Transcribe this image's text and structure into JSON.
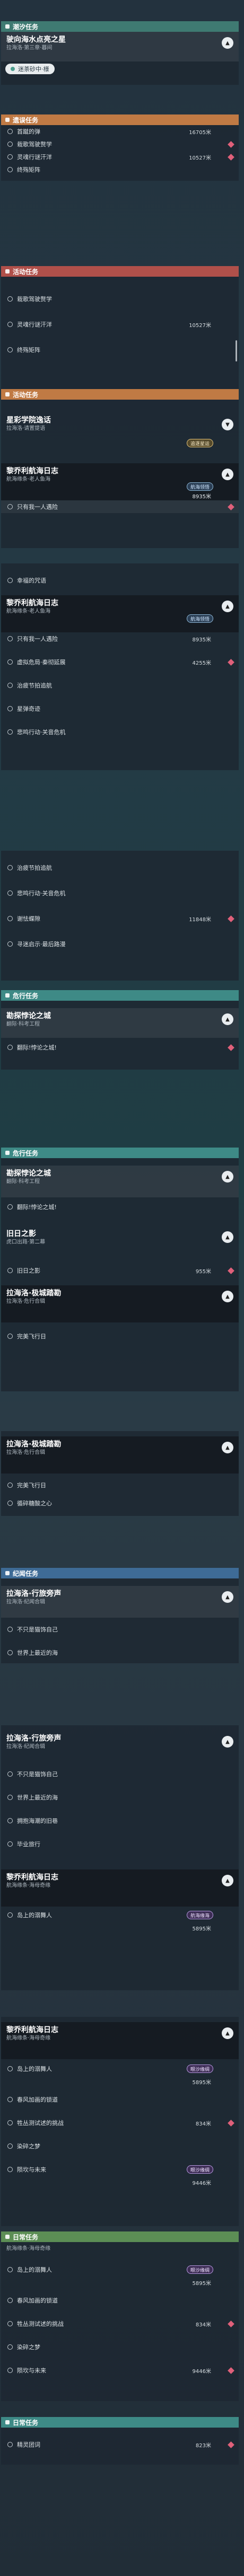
{
  "p1": {
    "header": "潮汐任务",
    "card": {
      "title": "驶向海水点亮之星",
      "sub": "拉海洛·第三章·暮间"
    },
    "pill": "迷茶砂中·様"
  },
  "p2": {
    "header": "遗误任务",
    "rows": [
      {
        "text": "首蹴的弹",
        "dist": "16705米"
      },
      {
        "text": "栽歌驾驶赘学",
        "dist": ""
      },
      {
        "text": "灵魂行谜汗洋",
        "dist": "10527米"
      },
      {
        "text": "终殇矩阵",
        "dist": ""
      }
    ]
  },
  "p3": {
    "header": "活动任务",
    "rows": [
      {
        "text": "栽歌驾驶赘学",
        "dist": ""
      },
      {
        "text": "灵魂行谜汗洋",
        "dist": "10527米"
      },
      {
        "text": "终殇矩阵",
        "dist": ""
      }
    ]
  },
  "p4": {
    "header": "活动任务",
    "card1": {
      "title": "星彩学院逸话",
      "sub": "拉海洛·请置提语"
    },
    "badge1": "追逐星运",
    "card2": {
      "title": "黎乔利航海日志",
      "sub": "航海缘条·老人鱼海"
    },
    "badge2": "航海领悟",
    "dist2": "8935米",
    "rows": [
      {
        "text": "只有我一人遇险",
        "dist": ""
      }
    ]
  },
  "p5": {
    "rows0": [
      {
        "text": "幸福的咒语",
        "dist": ""
      }
    ],
    "card": {
      "title": "黎乔利航海日志",
      "sub": "航海缘条·老人鱼海"
    },
    "badge": "航海领悟",
    "dist": "8935米",
    "rows": [
      {
        "text": "只有我一人遇险",
        "dist": "8935米"
      },
      {
        "text": "虚拟危局·秦彻延展",
        "dist": "4255米"
      },
      {
        "text": "治疲节拍追航",
        "dist": ""
      },
      {
        "text": "星弹奇迹",
        "dist": ""
      },
      {
        "text": "悲鸣行动·关音危机",
        "dist": ""
      }
    ]
  },
  "p6": {
    "rows": [
      {
        "text": "治疲节拍追航",
        "dist": ""
      },
      {
        "text": "悲鸣行动·关音危机",
        "dist": ""
      },
      {
        "text": "谢怯蝶隙",
        "dist": "11848米"
      },
      {
        "text": "寻迷启示·最后路漫",
        "dist": ""
      }
    ]
  },
  "p7": {
    "header": "危行任务",
    "card": {
      "title": "勘探悖论之城",
      "sub": "翻际·科考工程"
    },
    "rows": [
      {
        "text": "翻际!悖论之城!",
        "dist": ""
      }
    ]
  },
  "p8": {
    "header": "危行任务",
    "card1": {
      "title": "勘探悖论之城",
      "sub": "翻际·科考工程"
    },
    "rows1": [
      {
        "text": "翻际!悖论之城!",
        "dist": ""
      }
    ],
    "card2": {
      "title": "旧日之影",
      "sub": "虎口出路·第二幕"
    },
    "rows2": [
      {
        "text": "旧日之影",
        "dist": "955米"
      }
    ],
    "card3": {
      "title": "拉海洛·极城踏勘",
      "sub": "拉海洛·危行合辑"
    },
    "rows3": [
      {
        "text": "完美飞行日",
        "dist": ""
      }
    ]
  },
  "p9": {
    "card": {
      "title": "拉海洛·极城踏勘",
      "sub": "拉海洛·危行合辑"
    },
    "rows": [
      {
        "text": "完美飞行日",
        "dist": ""
      },
      {
        "text": "循碎糖酸之心",
        "dist": ""
      }
    ]
  },
  "p10": {
    "header": "纪闻任务",
    "card": {
      "title": "拉海洛·行旅旁声",
      "sub": "拉海洛·纪闻合辑"
    },
    "rows": [
      {
        "text": "不只是猫饰自己",
        "dist": ""
      },
      {
        "text": "世界上最近的海",
        "dist": ""
      }
    ]
  },
  "p11": {
    "card1": {
      "title": "拉海洛·行旅旁声",
      "sub": "拉海洛·纪闻合辑"
    },
    "rows1": [
      {
        "text": "不只是猫饰自己",
        "dist": ""
      },
      {
        "text": "世界上最近的海",
        "dist": ""
      },
      {
        "text": "拥抱海潮的旧巷",
        "dist": ""
      },
      {
        "text": "毕业旅行",
        "dist": ""
      }
    ],
    "card2": {
      "title": "黎乔利航海日志",
      "sub": "航海缘条·海母奇缘"
    },
    "rows2": [
      {
        "text": "岛上的溺舞人",
        "dist": "5895米"
      }
    ],
    "badge": "航海缘海",
    "dist": "5895米"
  },
  "p12": {
    "card": {
      "title": "黎乔利航海日志",
      "sub": "航海缘条·海母奇缘"
    },
    "rows": [
      {
        "text": "岛上的溺舞人",
        "dist": "5895米"
      },
      {
        "text": "春风加画的锁道",
        "dist": ""
      },
      {
        "text": "牲丛测试述的挑战",
        "dist": "834米"
      },
      {
        "text": "染碎之梦",
        "dist": ""
      },
      {
        "text": "陨坎与未来",
        "dist": "9446米"
      }
    ],
    "badge1": "眼沙缘绸",
    "badge2": "眼沙缘绸"
  },
  "p13": {
    "header": "日常任务",
    "card": {
      "title": "",
      "sub": "航海缘条·海母奇缘"
    },
    "rows": [
      {
        "text": "岛上的溺舞人",
        "dist": "5895米"
      },
      {
        "text": "春风加画的锁道",
        "dist": ""
      },
      {
        "text": "牲丛测试述的挑战",
        "dist": "834米"
      },
      {
        "text": "染碎之梦",
        "dist": ""
      },
      {
        "text": "陨坎与未来",
        "dist": "9446米"
      }
    ],
    "badge": "眼沙缘绸"
  },
  "p14": {
    "header": "日常任务",
    "rows": [
      {
        "text": "精灵团词",
        "dist": "823米"
      }
    ]
  }
}
